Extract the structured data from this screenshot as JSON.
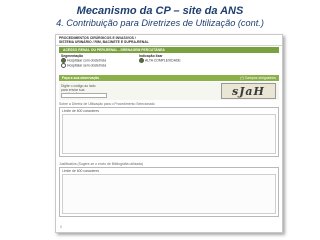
{
  "slide": {
    "title": "Mecanismo da CP – site da ANS",
    "subtitle": "4. Contribuição para Diretrizes de Utilização (cont.)"
  },
  "form": {
    "header_line1": "PROCEDIMENTOS CIRÚRGICOS E INVASIVOS /",
    "header_line2": "SISTEMA URINÁRIO / RIM, BACINETE E SUPRA-RENAL",
    "procedure_title": "ACESSO RENAL OU PERI-RENAL - DRENAGEM PERCUTÂNEA",
    "segmentation_label": "Segmentação",
    "segmentation_options": [
      "Hospitalar com obstetrícia",
      "Hospitalar sem obstetrícia"
    ],
    "indication_label": "Indicação lixar",
    "indication_option": "ALTA COMPLEXIDADE",
    "observations_bar_left": "Faça a sua observação",
    "observations_bar_right": "(*) Campos obrigatórios",
    "captcha_instruction": "Digite o código ao lado para enviar sua contribuição",
    "captcha_code": "sJaH",
    "guideline_section_label": "Sobre a Diretriz de Utilização para o Procedimento Selecionado",
    "guideline_caption": "Limite de 600 caracteres",
    "justification_section_label": "Justificativa (Sugere-se o envio de Bibliografia utilizada)",
    "justification_caption": "Limite de 600 caracteres",
    "page_number": "0"
  },
  "colors": {
    "title_blue": "#1f3f6f",
    "strip_green": "#7aa140",
    "bar_green": "#8bb04a"
  }
}
